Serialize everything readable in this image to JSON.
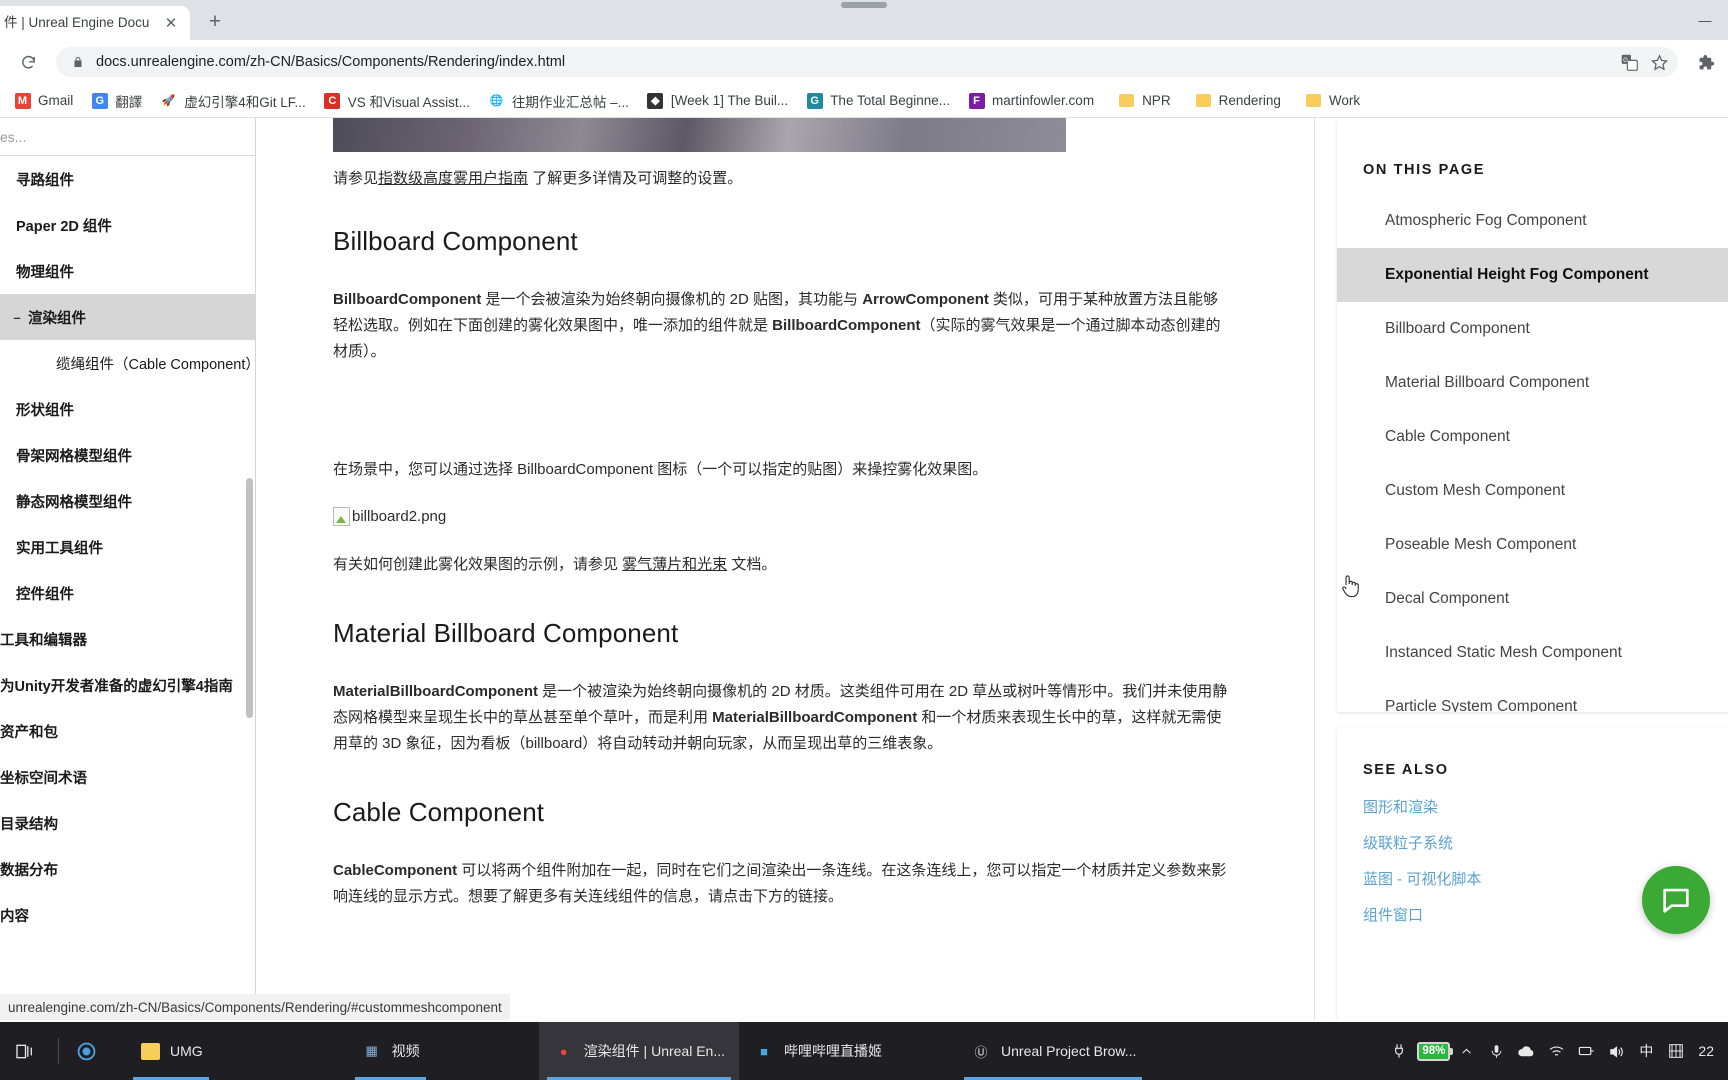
{
  "browser": {
    "tab": {
      "title": "件 | Unreal Engine Docu",
      "close_icon": "close-icon"
    },
    "new_tab_label": "+",
    "window_controls": {
      "minimize": "—",
      "maximize": "□",
      "close": "✕"
    },
    "reload_icon": "reload-icon",
    "url": "docs.unrealengine.com/zh-CN/Basics/Components/Rendering/index.html",
    "lock_icon": "lock-icon",
    "translate_icon": "translate-icon",
    "bookmark_star_icon": "star-icon",
    "extensions_icon": "puzzle-icon",
    "bookmarks": [
      {
        "label": "Gmail",
        "icon": "gmail-icon",
        "icon_glyph": "M",
        "color": "#ea4335",
        "type": "site"
      },
      {
        "label": "翻譯",
        "icon": "google-translate-icon",
        "icon_glyph": "G",
        "color": "#4285f4",
        "type": "site"
      },
      {
        "label": "虚幻引擎4和Git LF...",
        "icon": "rocket-icon",
        "icon_glyph": "🚀",
        "color": "#d93025",
        "type": "site"
      },
      {
        "label": "VS 和Visual Assist...",
        "icon": "c-icon",
        "icon_glyph": "C",
        "color": "#d93025",
        "type": "site"
      },
      {
        "label": "往期作业汇总帖 –...",
        "icon": "globe-icon",
        "icon_glyph": "🌐",
        "color": "#1a73e8",
        "type": "site"
      },
      {
        "label": "[Week 1] The Buil...",
        "icon": "dark-site-icon",
        "icon_glyph": "◆",
        "color": "#333333",
        "type": "site"
      },
      {
        "label": "The Total Beginne...",
        "icon": "teal-globe-icon",
        "icon_glyph": "G",
        "color": "#1f8aa0",
        "type": "site"
      },
      {
        "label": "martinfowler.com",
        "icon": "f-icon",
        "icon_glyph": "F",
        "color": "#7b1fa2",
        "type": "site"
      },
      {
        "label": "NPR",
        "icon": "folder-icon",
        "icon_glyph": "",
        "color": "#f7ce5b",
        "type": "folder"
      },
      {
        "label": "Rendering",
        "icon": "folder-icon",
        "icon_glyph": "",
        "color": "#f7ce5b",
        "type": "folder"
      },
      {
        "label": "Work",
        "icon": "folder-icon",
        "icon_glyph": "",
        "color": "#f7ce5b",
        "type": "folder"
      }
    ],
    "status_link": "unrealengine.com/zh-CN/Basics/Components/Rendering/#custommeshcomponent"
  },
  "docnav": {
    "search_value": "es...",
    "items": [
      {
        "label": "寻路组件",
        "level": 1,
        "active": false,
        "twisty": ""
      },
      {
        "label": "Paper 2D 组件",
        "level": 1,
        "active": false,
        "twisty": ""
      },
      {
        "label": "物理组件",
        "level": 1,
        "active": false,
        "twisty": ""
      },
      {
        "label": "渲染组件",
        "level": 1,
        "active": true,
        "twisty": "–"
      },
      {
        "label": "缆绳组件（Cable Component）",
        "level": 2,
        "active": false,
        "twisty": ""
      },
      {
        "label": "形状组件",
        "level": 1,
        "active": false,
        "twisty": ""
      },
      {
        "label": "骨架网格模型组件",
        "level": 1,
        "active": false,
        "twisty": ""
      },
      {
        "label": "静态网格模型组件",
        "level": 1,
        "active": false,
        "twisty": ""
      },
      {
        "label": "实用工具组件",
        "level": 1,
        "active": false,
        "twisty": ""
      },
      {
        "label": "控件组件",
        "level": 1,
        "active": false,
        "twisty": ""
      },
      {
        "label": "工具和编辑器",
        "level": 0,
        "active": false,
        "twisty": ""
      },
      {
        "label": "为Unity开发者准备的虚幻引擎4指南",
        "level": 0,
        "active": false,
        "twisty": ""
      },
      {
        "label": "资产和包",
        "level": 0,
        "active": false,
        "twisty": ""
      },
      {
        "label": "坐标空间术语",
        "level": 0,
        "active": false,
        "twisty": ""
      },
      {
        "label": "目录结构",
        "level": 0,
        "active": false,
        "twisty": ""
      },
      {
        "label": "数据分布",
        "level": 0,
        "active": false,
        "twisty": ""
      },
      {
        "label": "内容",
        "level": 0,
        "active": false,
        "twisty": ""
      }
    ]
  },
  "article": {
    "intro_prefix": "请参见",
    "intro_link": "指数级高度雾用户指南",
    "intro_suffix": " 了解更多详情及可调整的设置。",
    "billboard": {
      "heading": "Billboard Component",
      "p1_a": "BillboardComponent",
      "p1_b": " 是一个会被渲染为始终朝向摄像机的 2D 贴图，其功能与 ",
      "p1_c": "ArrowComponent",
      "p1_d": " 类似，可用于某种放置方法且能够轻松选取。例如在下面创建的雾化效果图中，唯一添加的组件就是 ",
      "p1_e": "BillboardComponent",
      "p1_f": "（实际的雾气效果是一个通过脚本动态创建的材质）。",
      "p2": "在场景中，您可以通过选择 BillboardComponent 图标（一个可以指定的贴图）来操控雾化效果图。",
      "p2_bold": "BillboardComponent",
      "image_alt": "billboard2.png",
      "p3_prefix": "有关如何创建此雾化效果图的示例，请参见 ",
      "p3_link": "雾气薄片和光束",
      "p3_suffix": " 文档。"
    },
    "material_billboard": {
      "heading": "Material Billboard Component",
      "p1_a": "MaterialBillboardComponent",
      "p1_b": " 是一个被渲染为始终朝向摄像机的 2D 材质。这类组件可用在 2D 草丛或树叶等情形中。我们并未使用静态网格模型来呈现生长中的草丛甚至单个草叶，而是利用 ",
      "p1_c": "MaterialBillboardComponent",
      "p1_d": " 和一个材质来表现生长中的草，这样就无需使用草的 3D 象征，因为看板（billboard）将自动转动并朝向玩家，从而呈现出草的三维表象。"
    },
    "cable": {
      "heading": "Cable Component",
      "p1_a": "CableComponent",
      "p1_b": " 可以将两个组件附加在一起，同时在它们之间渲染出一条连线。在这条连线上，您可以指定一个材质并定义参数来影响连线的显示方式。想要了解更多有关连线组件的信息，请点击下方的链接。"
    }
  },
  "toc": {
    "title": "ON THIS PAGE",
    "items": [
      {
        "label": "Atmospheric Fog Component",
        "active": false
      },
      {
        "label": "Exponential Height Fog Component",
        "active": true
      },
      {
        "label": "Billboard Component",
        "active": false
      },
      {
        "label": "Material Billboard Component",
        "active": false
      },
      {
        "label": "Cable Component",
        "active": false
      },
      {
        "label": "Custom Mesh Component",
        "active": false
      },
      {
        "label": "Poseable Mesh Component",
        "active": false
      },
      {
        "label": "Decal Component",
        "active": false
      },
      {
        "label": "Instanced Static Mesh Component",
        "active": false
      },
      {
        "label": "Particle System Component",
        "active": false
      }
    ]
  },
  "see_also": {
    "title": "SEE ALSO",
    "links": [
      {
        "label": "图形和渲染"
      },
      {
        "label": "级联粒子系统"
      },
      {
        "label": "蓝图 - 可视化脚本"
      },
      {
        "label": "组件窗口"
      }
    ],
    "link_color": "#5aa3d0"
  },
  "chat_widget": {
    "icon": "chat-bubble-icon",
    "color": "#3aaa35"
  },
  "taskbar": {
    "start_icon": "task-view-icon",
    "cortana_icon": "cortana-icon",
    "tasks": [
      {
        "label": "UMG",
        "icon": "folder-icon",
        "icon_glyph": "",
        "color": "#f7ce5b",
        "active": false,
        "running": true
      },
      {
        "label": "视频",
        "icon": "video-folder-icon",
        "icon_glyph": "▦",
        "color": "#8ab4d8",
        "active": false,
        "running": true
      },
      {
        "label": "渲染组件 | Unreal En...",
        "icon": "chrome-icon",
        "icon_glyph": "●",
        "color": "#e8453c",
        "active": true,
        "running": true
      },
      {
        "label": "哔哩哔哩直播姬",
        "icon": "bilibili-icon",
        "icon_glyph": "■",
        "color": "#4aa8e0",
        "active": false,
        "running": false
      },
      {
        "label": "Unreal Project Brow...",
        "icon": "unreal-icon",
        "icon_glyph": "Ⓤ",
        "color": "#dddddd",
        "active": false,
        "running": true
      }
    ],
    "tray": [
      {
        "name": "plug-icon",
        "glyph": "🔌"
      },
      {
        "name": "battery-icon",
        "glyph": "98%"
      },
      {
        "name": "chevron-up-icon",
        "glyph": "∧"
      },
      {
        "name": "microphone-icon",
        "glyph": "🎙"
      },
      {
        "name": "onedrive-cloud-icon",
        "glyph": "☁"
      },
      {
        "name": "wifi-icon",
        "glyph": "📶"
      },
      {
        "name": "network-icon",
        "glyph": "🖧"
      },
      {
        "name": "volume-icon",
        "glyph": "🔊"
      },
      {
        "name": "ime-chinese-icon",
        "glyph": "中"
      },
      {
        "name": "ime-keyboard-icon",
        "glyph": "⌸"
      }
    ],
    "battery_percent": "98%",
    "clock": "22"
  }
}
